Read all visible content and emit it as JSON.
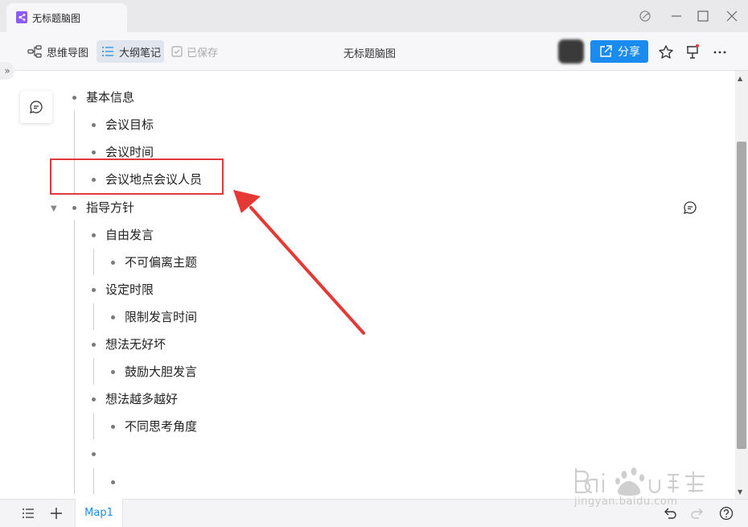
{
  "window": {
    "tab_title": "无标题脑图"
  },
  "toolbar": {
    "mindmap_label": "思维导图",
    "outline_label": "大纲笔记",
    "saved_label": "已保存",
    "doc_title": "无标题脑图",
    "share_label": "分享"
  },
  "outline": {
    "n1": "基本信息",
    "n1_1": "会议目标",
    "n1_2": "会议时间",
    "n1_3": "会议地点会议人员",
    "n2": "指导方针",
    "n2_1": "自由发言",
    "n2_1_1": "不可偏离主题",
    "n2_2": "设定时限",
    "n2_2_1": "限制发言时间",
    "n2_3": "想法无好坏",
    "n2_3_1": "鼓励大胆发言",
    "n2_4": "想法越多越好",
    "n2_4_1": "不同思考角度"
  },
  "bottom": {
    "sheet_tab": "Map1"
  },
  "watermark": {
    "sub_text": "jingyan.baidu.com"
  },
  "colors": {
    "accent": "#1a8cf0",
    "highlight": "#e03a3a"
  },
  "icons": [
    "app-icon",
    "refresh-icon",
    "minimize-icon",
    "maximize-icon",
    "close-icon",
    "mindmap-icon",
    "outline-icon",
    "saved-icon",
    "share-icon",
    "star-icon",
    "present-icon",
    "more-icon",
    "comment-icon",
    "list-icon",
    "plus-icon",
    "undo-icon",
    "redo-icon",
    "help-icon"
  ]
}
